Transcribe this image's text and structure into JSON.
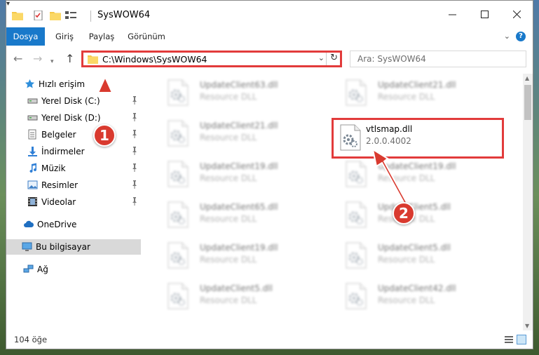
{
  "window": {
    "title": "SysWOW64"
  },
  "ribbon": {
    "tabs": [
      "Dosya",
      "Giriş",
      "Paylaş",
      "Görünüm"
    ],
    "help": "?"
  },
  "nav": {
    "address": "C:\\Windows\\SysWOW64",
    "search_placeholder": "Ara: SysWOW64"
  },
  "sidebar": {
    "items": [
      {
        "label": "Hızlı erişim",
        "icon": "star-icon"
      },
      {
        "label": "Yerel Disk (C:)",
        "icon": "drive-icon",
        "pinned": true
      },
      {
        "label": "Yerel Disk (D:)",
        "icon": "drive-icon",
        "pinned": true
      },
      {
        "label": "Belgeler",
        "icon": "documents-icon",
        "pinned": true
      },
      {
        "label": "İndirmeler",
        "icon": "download-icon",
        "pinned": true
      },
      {
        "label": "Müzik",
        "icon": "music-icon",
        "pinned": true
      },
      {
        "label": "Resimler",
        "icon": "pictures-icon",
        "pinned": true
      },
      {
        "label": "Videolar",
        "icon": "videos-icon",
        "pinned": true
      },
      {
        "label": "OneDrive",
        "icon": "cloud-icon"
      },
      {
        "label": "Bu bilgisayar",
        "icon": "computer-icon",
        "selected": true
      },
      {
        "label": "Ağ",
        "icon": "network-icon"
      }
    ]
  },
  "files": [
    {
      "name": "UpdateClient63.dll",
      "desc": "Resource DLL",
      "blurred": true
    },
    {
      "name": "UpdateClient21.dll",
      "desc": "Resource DLL",
      "blurred": true
    },
    {
      "name": "UpdateClient21.dll",
      "desc": "Resource DLL",
      "blurred": true
    },
    {
      "name": "vtlsmap.dll",
      "desc": "2.0.0.4002",
      "blurred": false,
      "highlighted": true
    },
    {
      "name": "UpdateClient19.dll",
      "desc": "Resource DLL",
      "blurred": true
    },
    {
      "name": "UpdateClient19.dll",
      "desc": "Resource DLL",
      "blurred": true
    },
    {
      "name": "UpdateClient65.dll",
      "desc": "Resource DLL",
      "blurred": true
    },
    {
      "name": "UpdateClient5.dll",
      "desc": "Resource DLL",
      "blurred": true
    },
    {
      "name": "UpdateClient19.dll",
      "desc": "Resource DLL",
      "blurred": true
    },
    {
      "name": "UpdateClient5.dll",
      "desc": "Resource DLL",
      "blurred": true
    },
    {
      "name": "UpdateClient5.dll",
      "desc": "Resource DLL",
      "blurred": true
    },
    {
      "name": "UpdateClient42.dll",
      "desc": "Resource DLL",
      "blurred": true
    }
  ],
  "status": {
    "item_count": "104 öğe"
  },
  "annotations": {
    "step1": "1",
    "step2": "2",
    "color": "#d93a2f"
  },
  "colors": {
    "accent": "#1979ca",
    "highlight": "#e23b3b"
  }
}
